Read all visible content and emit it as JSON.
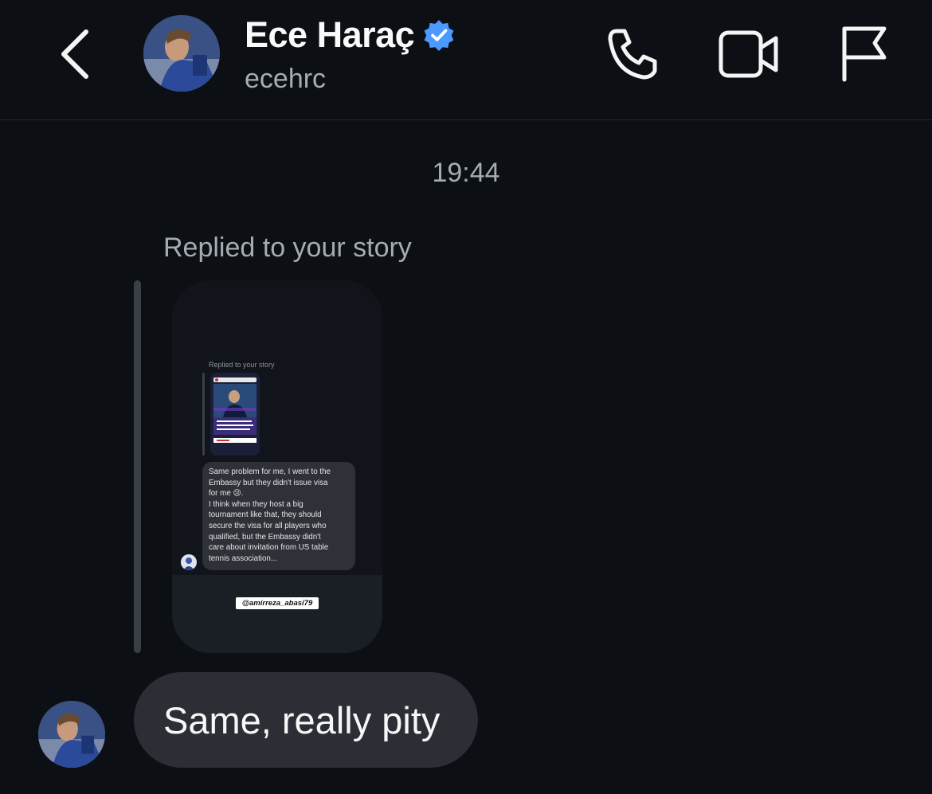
{
  "header": {
    "display_name": "Ece Haraç",
    "username": "ecehrc",
    "verified": true,
    "icons": {
      "back": "chevron-left-icon",
      "verified": "verified-badge-icon",
      "call": "phone-icon",
      "video": "video-camera-icon",
      "report": "flag-icon"
    }
  },
  "thread": {
    "timestamp": "19:44",
    "story_reply_label": "Replied to your story",
    "story_preview": {
      "inner_label": "Replied to your story",
      "inner_message": [
        "Same problem for me, I went to the",
        "Embassy but they didn't issue visa",
        "for me 😢.",
        "I think when they host a big",
        "tournament like that, they should",
        "secure the visa for all players who",
        "qualified, but the Embassy didn't",
        "care about invitation from US table",
        "tennis association..."
      ],
      "mention": "@amirreza_abasi79"
    },
    "message": "Same, really pity"
  },
  "colors": {
    "background": "#0c0f14",
    "bubble": "#2b2e34",
    "verified_blue": "#4c9aff",
    "secondary_text": "#a7abb2"
  }
}
